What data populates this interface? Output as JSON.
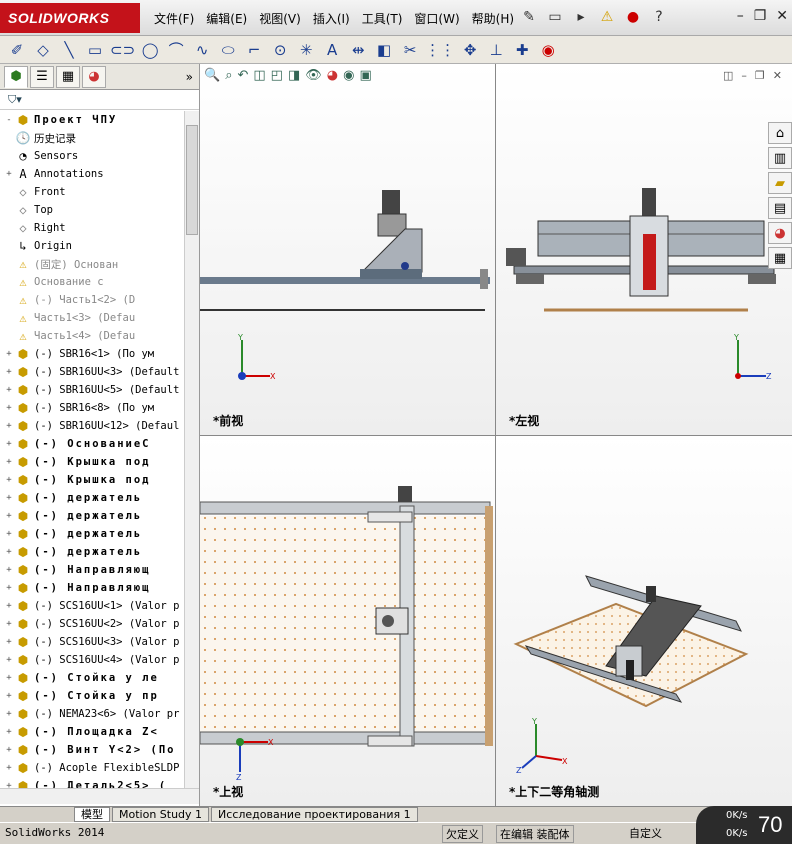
{
  "app": {
    "brand": "SOLIDWORKS",
    "status_app": "SolidWorks 2014"
  },
  "menu": [
    "文件(F)",
    "编辑(E)",
    "视图(V)",
    "插入(I)",
    "工具(T)",
    "窗口(W)",
    "帮助(H)"
  ],
  "toolbar_icons": [
    "sketch-icon",
    "smart-dimension-icon",
    "line-icon",
    "rectangle-icon",
    "slot-icon",
    "circle-icon",
    "arc-icon",
    "spline-icon",
    "ellipse-icon",
    "fillet-icon",
    "offset-icon",
    "point-icon",
    "text-icon",
    "mirror-icon",
    "convert-icon",
    "trim-icon",
    "pattern-icon",
    "move-icon",
    "relations-icon",
    "repair-icon",
    "display-icon"
  ],
  "feature_tree": [
    {
      "label": "Проект ЧПУ",
      "icon": "assembly-icon",
      "style": "bold",
      "expand": "-"
    },
    {
      "label": "历史记录",
      "icon": "history-icon",
      "style": "normal",
      "expand": ""
    },
    {
      "label": "Sensors",
      "icon": "sensor-icon",
      "style": "normal",
      "expand": ""
    },
    {
      "label": "Annotations",
      "icon": "annotation-icon",
      "style": "normal",
      "expand": "+"
    },
    {
      "label": "Front",
      "icon": "plane-icon",
      "style": "normal",
      "expand": ""
    },
    {
      "label": "Top",
      "icon": "plane-icon",
      "style": "normal",
      "expand": ""
    },
    {
      "label": "Right",
      "icon": "plane-icon",
      "style": "normal",
      "expand": ""
    },
    {
      "label": "Origin",
      "icon": "origin-icon",
      "style": "normal",
      "expand": ""
    },
    {
      "label": "(固定) Основан",
      "icon": "warning-icon",
      "style": "grey",
      "expand": ""
    },
    {
      "label": "Основание с",
      "icon": "warning-icon",
      "style": "grey",
      "expand": ""
    },
    {
      "label": "(-) Часть1<2> (D",
      "icon": "warning-icon",
      "style": "grey",
      "expand": ""
    },
    {
      "label": "Часть1<3> (Defau",
      "icon": "warning-icon",
      "style": "grey",
      "expand": ""
    },
    {
      "label": "Часть1<4> (Defau",
      "icon": "warning-icon",
      "style": "grey",
      "expand": ""
    },
    {
      "label": "(-) SBR16<1> (По ум",
      "icon": "part-icon",
      "style": "normal",
      "expand": "+"
    },
    {
      "label": "(-) SBR16UU<3> (Default",
      "icon": "part-icon",
      "style": "normal",
      "expand": "+"
    },
    {
      "label": "(-) SBR16UU<5> (Default",
      "icon": "part-icon",
      "style": "normal",
      "expand": "+"
    },
    {
      "label": "(-) SBR16<8> (По ум",
      "icon": "part-icon",
      "style": "normal",
      "expand": "+"
    },
    {
      "label": "(-) SBR16UU<12> (Defaul",
      "icon": "part-icon",
      "style": "normal",
      "expand": "+"
    },
    {
      "label": "(-) ОснованиеС",
      "icon": "part-icon",
      "style": "bold",
      "expand": "+"
    },
    {
      "label": "(-) Крышка под",
      "icon": "part-icon",
      "style": "bold",
      "expand": "+"
    },
    {
      "label": "(-) Крышка под",
      "icon": "part-icon",
      "style": "bold",
      "expand": "+"
    },
    {
      "label": "(-) держатель",
      "icon": "part-icon",
      "style": "bold",
      "expand": "+"
    },
    {
      "label": "(-) держатель",
      "icon": "part-icon",
      "style": "bold",
      "expand": "+"
    },
    {
      "label": "(-) держатель",
      "icon": "part-icon",
      "style": "bold",
      "expand": "+"
    },
    {
      "label": "(-) держатель",
      "icon": "part-icon",
      "style": "bold",
      "expand": "+"
    },
    {
      "label": "(-) Направляющ",
      "icon": "part-icon",
      "style": "bold",
      "expand": "+"
    },
    {
      "label": "(-) Направляющ",
      "icon": "part-icon",
      "style": "bold",
      "expand": "+"
    },
    {
      "label": "(-) SCS16UU<1> (Valor p",
      "icon": "part-icon",
      "style": "normal",
      "expand": "+"
    },
    {
      "label": "(-) SCS16UU<2> (Valor p",
      "icon": "part-icon",
      "style": "normal",
      "expand": "+"
    },
    {
      "label": "(-) SCS16UU<3> (Valor p",
      "icon": "part-icon",
      "style": "normal",
      "expand": "+"
    },
    {
      "label": "(-) SCS16UU<4> (Valor p",
      "icon": "part-icon",
      "style": "normal",
      "expand": "+"
    },
    {
      "label": "(-) Стойка у ле",
      "icon": "part-icon",
      "style": "bold",
      "expand": "+"
    },
    {
      "label": "(-) Стойка у пр",
      "icon": "part-icon",
      "style": "bold",
      "expand": "+"
    },
    {
      "label": "(-) NEMA23<6> (Valor pr",
      "icon": "part-icon",
      "style": "normal",
      "expand": "+"
    },
    {
      "label": "(-) Площадка Z<",
      "icon": "part-icon",
      "style": "bold",
      "expand": "+"
    },
    {
      "label": "(-) Винт Y<2> (По",
      "icon": "part-icon",
      "style": "bold",
      "expand": "+"
    },
    {
      "label": "(-) Acople FlexibleSLDP",
      "icon": "part-icon",
      "style": "normal",
      "expand": "+"
    },
    {
      "label": "(-) Деталь2<5> (",
      "icon": "part-icon",
      "style": "bold",
      "expand": "+"
    }
  ],
  "viewports": {
    "front": "*前视",
    "left": "*左视",
    "top": "*上视",
    "iso": "*上下二等角轴测"
  },
  "bottom_tabs": [
    "模型",
    "Motion Study 1",
    "Исследование проектирования 1"
  ],
  "status": {
    "undefined": "欠定义",
    "editing": "在编辑 装配体",
    "custom": "自定义"
  },
  "network": {
    "up": "0K/s",
    "down": "0K/s",
    "percent": "70"
  }
}
